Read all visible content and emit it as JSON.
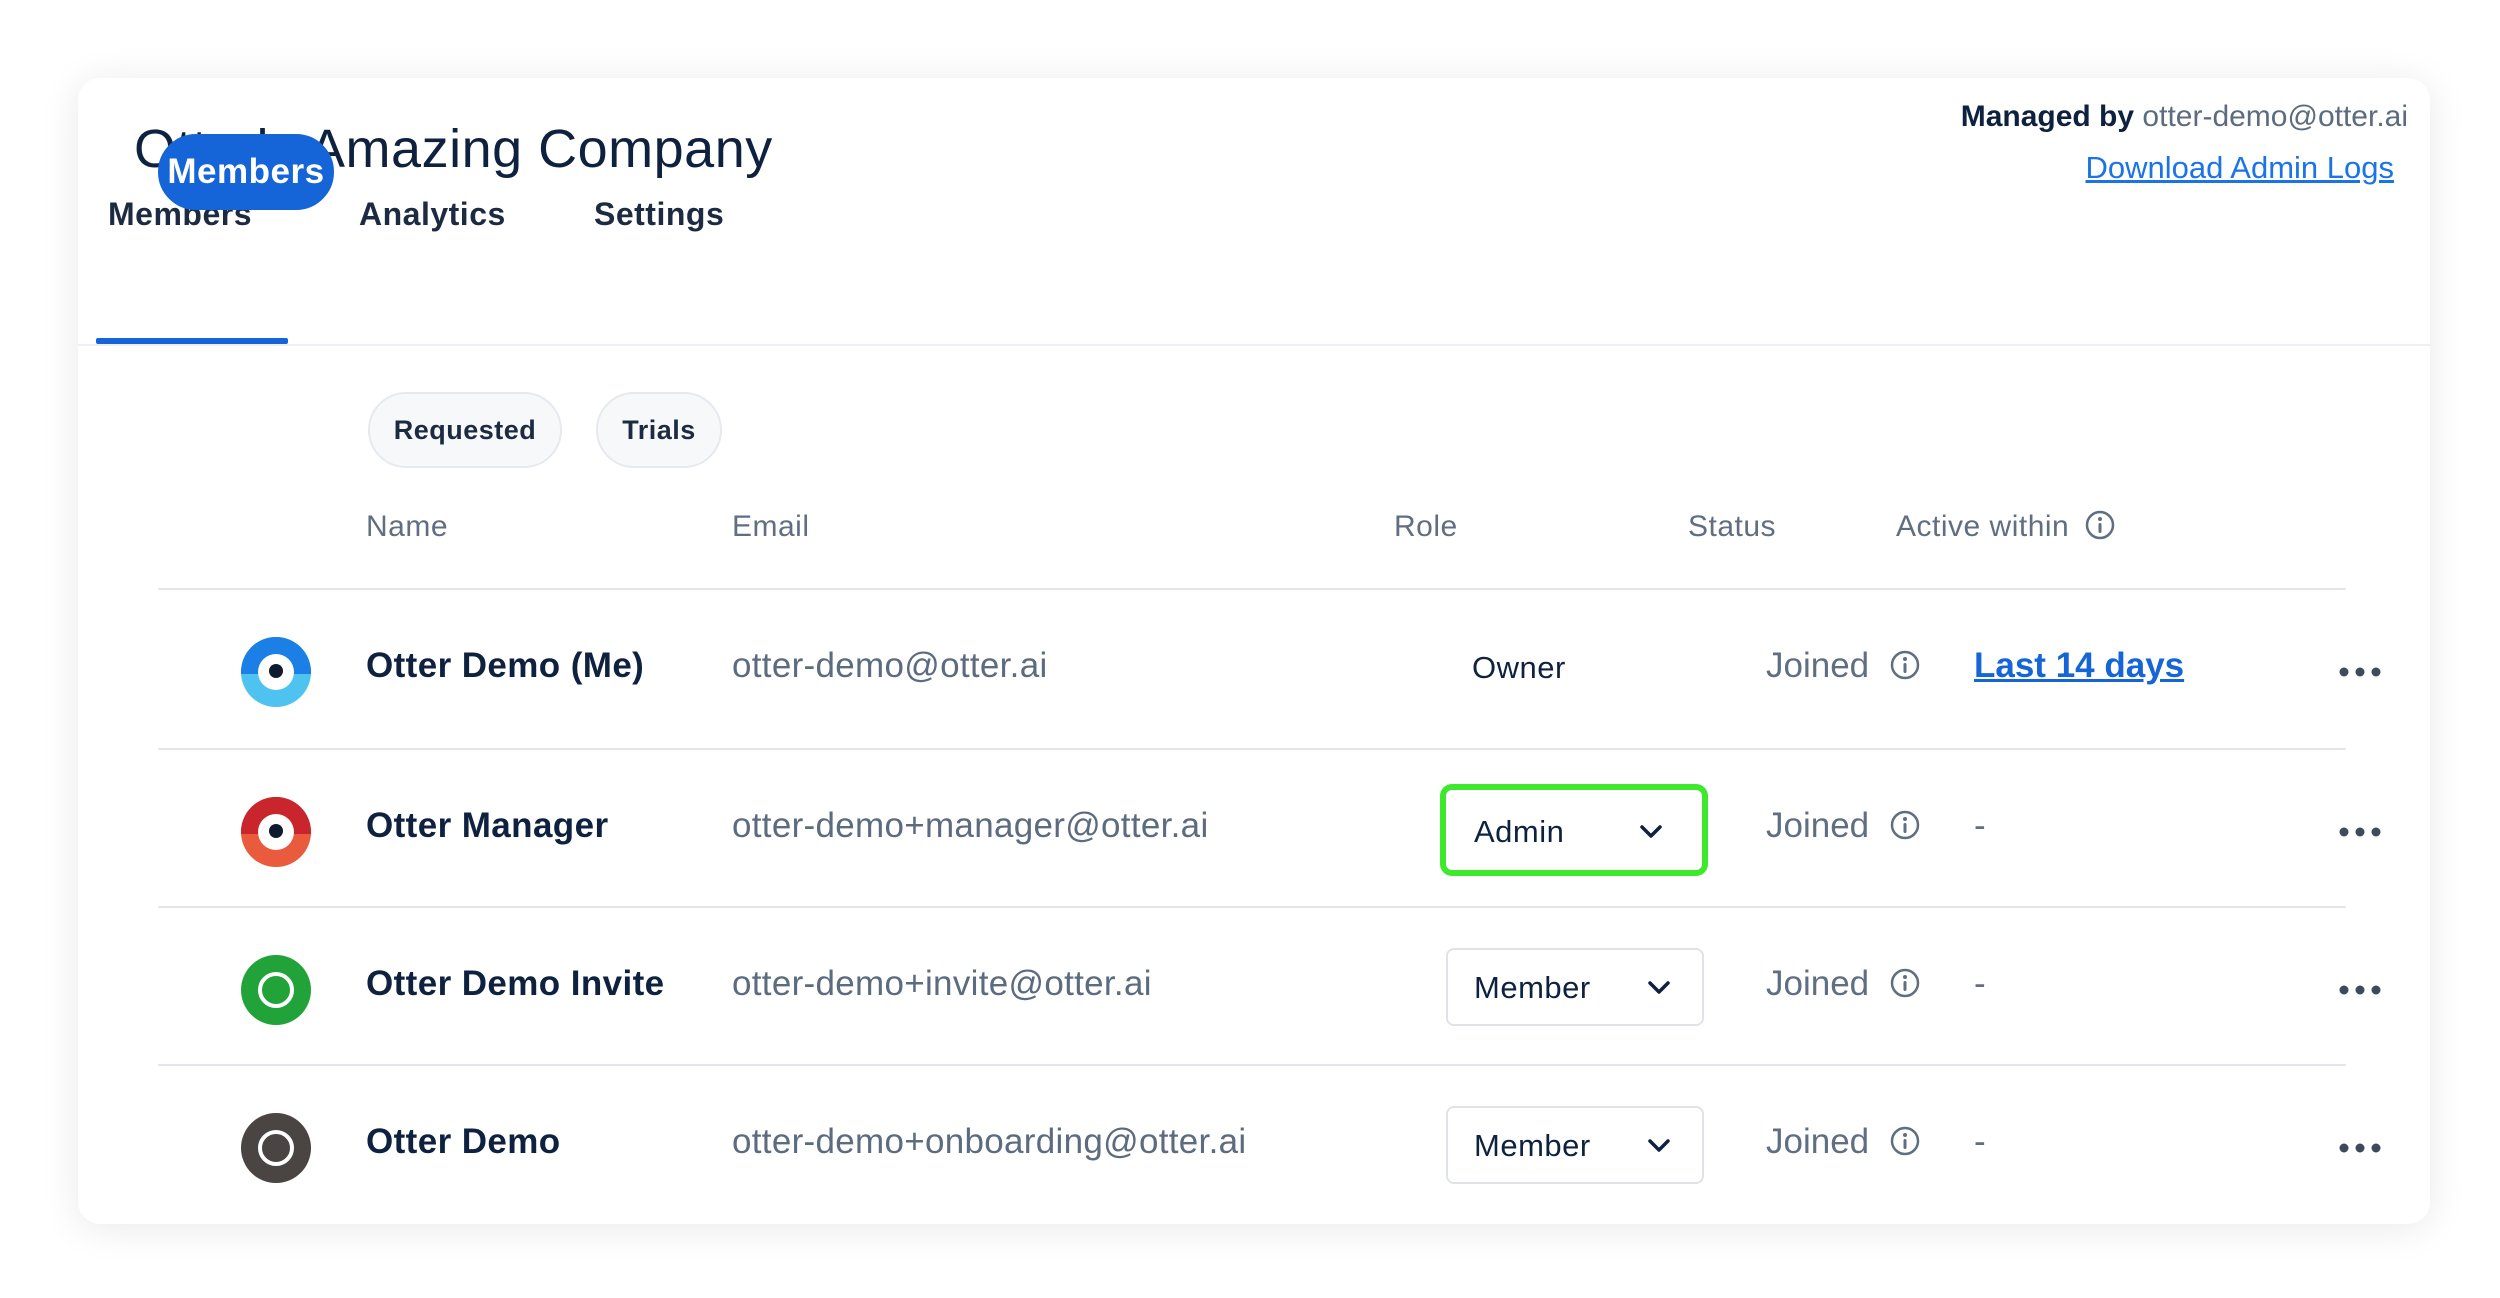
{
  "header": {
    "org_name": "Otterly Amazing Company",
    "managed_by_label": "Managed by",
    "managed_by_email": "otter-demo@otter.ai",
    "download_logs": "Download Admin Logs"
  },
  "tabs": [
    {
      "label": "Members",
      "active": true
    },
    {
      "label": "Analytics",
      "active": false
    },
    {
      "label": "Settings",
      "active": false
    }
  ],
  "filters": [
    {
      "label": "Members",
      "active": true
    },
    {
      "label": "Requested",
      "active": false
    },
    {
      "label": "Trials",
      "active": false
    }
  ],
  "columns": {
    "name": "Name",
    "email": "Email",
    "role": "Role",
    "status": "Status",
    "active_within": "Active within"
  },
  "members": [
    {
      "name": "Otter Demo (Me)",
      "email": "otter-demo@otter.ai",
      "role": "Owner",
      "role_editable": false,
      "status": "Joined",
      "active_within": "Last 14 days",
      "avatar": "blue-otter-avatar",
      "avatar_color": "#2f86e8"
    },
    {
      "name": "Otter Manager",
      "email": "otter-demo+manager@otter.ai",
      "role": "Admin",
      "role_editable": true,
      "highlighted": true,
      "status": "Joined",
      "active_within": "-",
      "avatar": "red-otter-avatar",
      "avatar_color": "#e2463a"
    },
    {
      "name": "Otter Demo Invite",
      "email": "otter-demo+invite@otter.ai",
      "role": "Member",
      "role_editable": true,
      "status": "Joined",
      "active_within": "-",
      "avatar": "green-ring-avatar",
      "avatar_color": "#22a33a"
    },
    {
      "name": "Otter Demo",
      "email": "otter-demo+onboarding@otter.ai",
      "role": "Member",
      "role_editable": true,
      "status": "Joined",
      "active_within": "-",
      "avatar": "dark-ring-avatar",
      "avatar_color": "#4a4443"
    }
  ],
  "colors": {
    "accent": "#1565d8",
    "highlight": "#3ee82c",
    "text_primary": "#0e2240",
    "text_secondary": "#5c6b7f"
  }
}
